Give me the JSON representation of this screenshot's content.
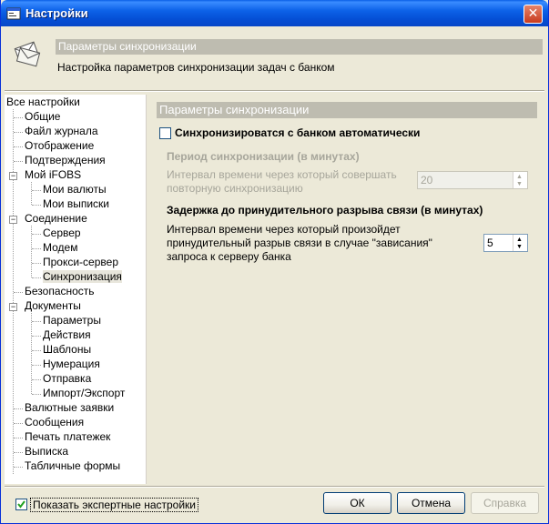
{
  "window": {
    "title": "Настройки"
  },
  "header": {
    "title": "Параметры синхронизации",
    "subtitle": "Настройка параметров синхронизации задач с банком"
  },
  "tree": {
    "items": [
      {
        "label": "Все настройки"
      },
      {
        "label": "Общие"
      },
      {
        "label": "Файл журнала"
      },
      {
        "label": "Отображение"
      },
      {
        "label": "Подтверждения"
      },
      {
        "label": "Мой iFOBS"
      },
      {
        "label": "Мои валюты"
      },
      {
        "label": "Мои выписки"
      },
      {
        "label": "Соединение"
      },
      {
        "label": "Сервер"
      },
      {
        "label": "Модем"
      },
      {
        "label": "Прокси-сервер"
      },
      {
        "label": "Синхронизация"
      },
      {
        "label": "Безопасность"
      },
      {
        "label": "Документы"
      },
      {
        "label": "Параметры"
      },
      {
        "label": "Действия"
      },
      {
        "label": "Шаблоны"
      },
      {
        "label": "Нумерация"
      },
      {
        "label": "Отправка"
      },
      {
        "label": "Импорт/Экспорт"
      },
      {
        "label": "Валютные заявки"
      },
      {
        "label": "Сообщения"
      },
      {
        "label": "Печать платежек"
      },
      {
        "label": "Выписка"
      },
      {
        "label": "Табличные формы"
      }
    ]
  },
  "panel": {
    "title": "Параметры синхронизации",
    "auto_sync_label": "Синхронизироватся с банком автоматически",
    "period_heading": "Период синхронизации (в минутах)",
    "period_text_1": "Интервал времени через который совершать",
    "period_text_2": "повторную синхронизацию",
    "period_value": "20",
    "delay_heading": "Задержка до принудительного разрыва связи (в минутах)",
    "delay_text_1": "Интервал времени через который произойдет",
    "delay_text_2": "принудительный разрыв связи в случае \"зависания\"",
    "delay_text_3": "запроса к серверу банка",
    "delay_value": "5"
  },
  "footer": {
    "expert_label": "Показать экспертные настройки",
    "ok": "ОК",
    "cancel": "Отмена",
    "apply": "Справка"
  },
  "colors": {
    "title_bar": "#0d62e8",
    "section_header": "#bebcb0",
    "dialog_bg": "#ece9d8"
  }
}
